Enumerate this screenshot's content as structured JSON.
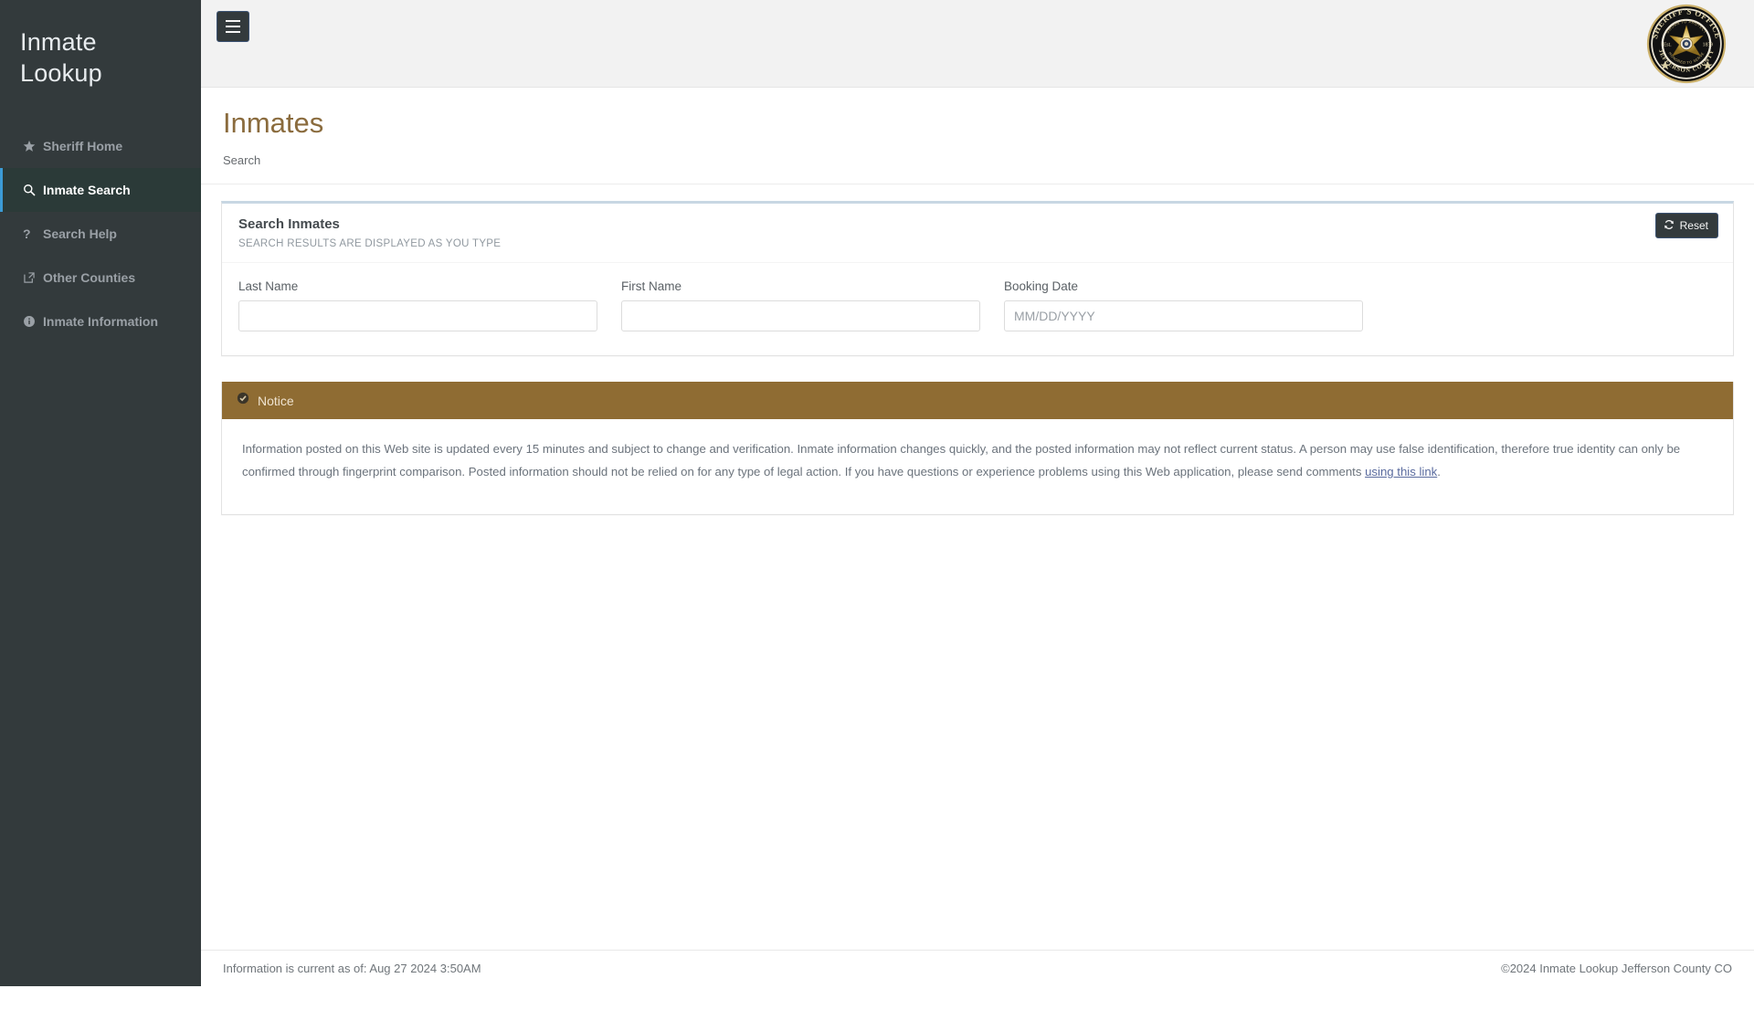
{
  "sidebar": {
    "brand": "Inmate Lookup",
    "items": [
      {
        "label": "Sheriff Home",
        "icon": "star-icon",
        "active": false
      },
      {
        "label": "Inmate Search",
        "icon": "search-icon",
        "active": true
      },
      {
        "label": "Search Help",
        "icon": "question-mark-icon",
        "active": false
      },
      {
        "label": "Other Counties",
        "icon": "external-link-icon",
        "active": false
      },
      {
        "label": "Inmate Information",
        "icon": "info-circle-icon",
        "active": false
      }
    ],
    "active_accent_color": "#3c9bd6",
    "active_background_color": "#2b3a38",
    "background_color": "#333a3c"
  },
  "topbar": {
    "menu_toggle_icon": "hamburger-icon",
    "badge": {
      "icon": "sheriff-badge-icon",
      "top_text": "SHERIFF'S OFFICE",
      "inner_top_text": "SWORN TO PROTECT",
      "inner_bottom_text": "HONORED TO SERVE",
      "left_text": "Est.",
      "right_text": "1859",
      "bottom_text": "JEFFERSON COUNTY"
    }
  },
  "page": {
    "title": "Inmates",
    "title_color": "#8a6b3d",
    "breadcrumb": "Search"
  },
  "search_panel": {
    "title": "Search Inmates",
    "subtitle": "SEARCH RESULTS ARE DISPLAYED AS YOU TYPE",
    "reset_label": "Reset",
    "reset_icon": "refresh-icon",
    "fields": [
      {
        "label": "Last Name",
        "value": "",
        "placeholder": ""
      },
      {
        "label": "First Name",
        "value": "",
        "placeholder": ""
      },
      {
        "label": "Booking Date",
        "value": "",
        "placeholder": "MM/DD/YYYY"
      }
    ]
  },
  "notice": {
    "title": "Notice",
    "icon": "check-circle-icon",
    "header_color": "#8f6c33",
    "text_before_link": "Information posted on this Web site is updated every 15 minutes and subject to change and verification. Inmate information changes quickly, and the posted information may not reflect current status. A person may use false identification, therefore true identity can only be confirmed through fingerprint comparison. Posted information should not be relied on for any type of legal action. If you have questions or experience problems using this Web application, please send comments ",
    "link_text": "using this link",
    "text_after_link": "."
  },
  "footer": {
    "left": "Information is current as of: Aug 27 2024 3:50AM",
    "right": "©2024 Inmate Lookup Jefferson County CO"
  }
}
